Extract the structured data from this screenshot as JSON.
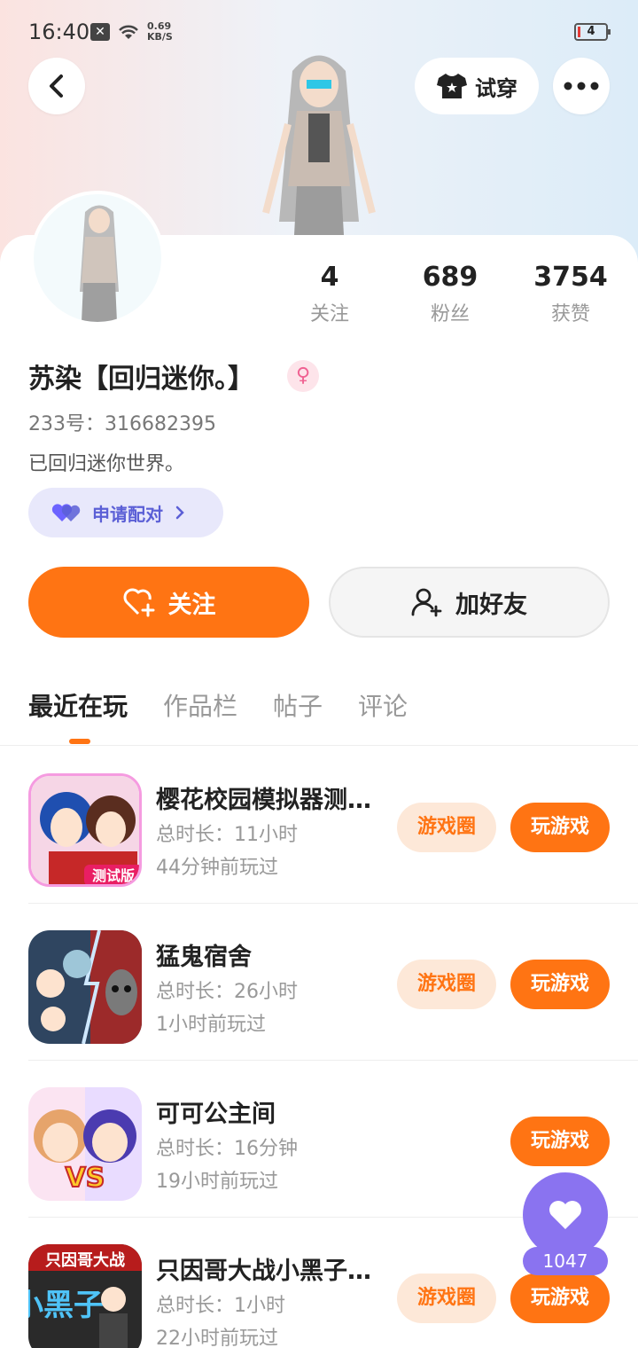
{
  "status_bar": {
    "time": "16:40",
    "net_speed_value": "0.69",
    "net_speed_unit": "KB/S",
    "battery_level": "4"
  },
  "header": {
    "try_on_label": "试穿"
  },
  "stats": [
    {
      "value": "4",
      "label": "关注"
    },
    {
      "value": "689",
      "label": "粉丝"
    },
    {
      "value": "3754",
      "label": "获赞"
    }
  ],
  "profile": {
    "name": "苏染【回归迷你。】",
    "gender_icon": "female-icon",
    "uid": "233号：316682395",
    "bio": "已回归迷你世界。",
    "pair_label": "申请配对"
  },
  "actions": {
    "follow_label": "关注",
    "add_friend_label": "加好友"
  },
  "tabs": [
    {
      "label": "最近在玩",
      "active": true
    },
    {
      "label": "作品栏",
      "active": false
    },
    {
      "label": "帖子",
      "active": false
    },
    {
      "label": "评论",
      "active": false
    }
  ],
  "games": [
    {
      "title": "樱花校园模拟器测试版",
      "duration": "总时长：11小时",
      "last_played": "44分钟前玩过",
      "circle_label": "游戏圈",
      "play_label": "玩游戏",
      "has_circle": true
    },
    {
      "title": "猛鬼宿舍",
      "duration": "总时长：26小时",
      "last_played": "1小时前玩过",
      "circle_label": "游戏圈",
      "play_label": "玩游戏",
      "has_circle": true
    },
    {
      "title": "可可公主间",
      "duration": "总时长：16分钟",
      "last_played": "19小时前玩过",
      "circle_label": "",
      "play_label": "玩游戏",
      "has_circle": false
    },
    {
      "title": "只因哥大战小黑子大作战",
      "duration": "总时长：1小时",
      "last_played": "22小时前玩过",
      "circle_label": "游戏圈",
      "play_label": "玩游戏",
      "has_circle": true
    }
  ],
  "icon_labels": {
    "game1_badge": "测试版",
    "game3_badge": "VS",
    "game4_top": "只因哥大战",
    "game4_main": "小黑子"
  },
  "like_fab": {
    "count": "1047"
  },
  "colors": {
    "accent": "#ff7413",
    "accent_soft": "#fde8d8",
    "purple": "#8a73f0"
  }
}
